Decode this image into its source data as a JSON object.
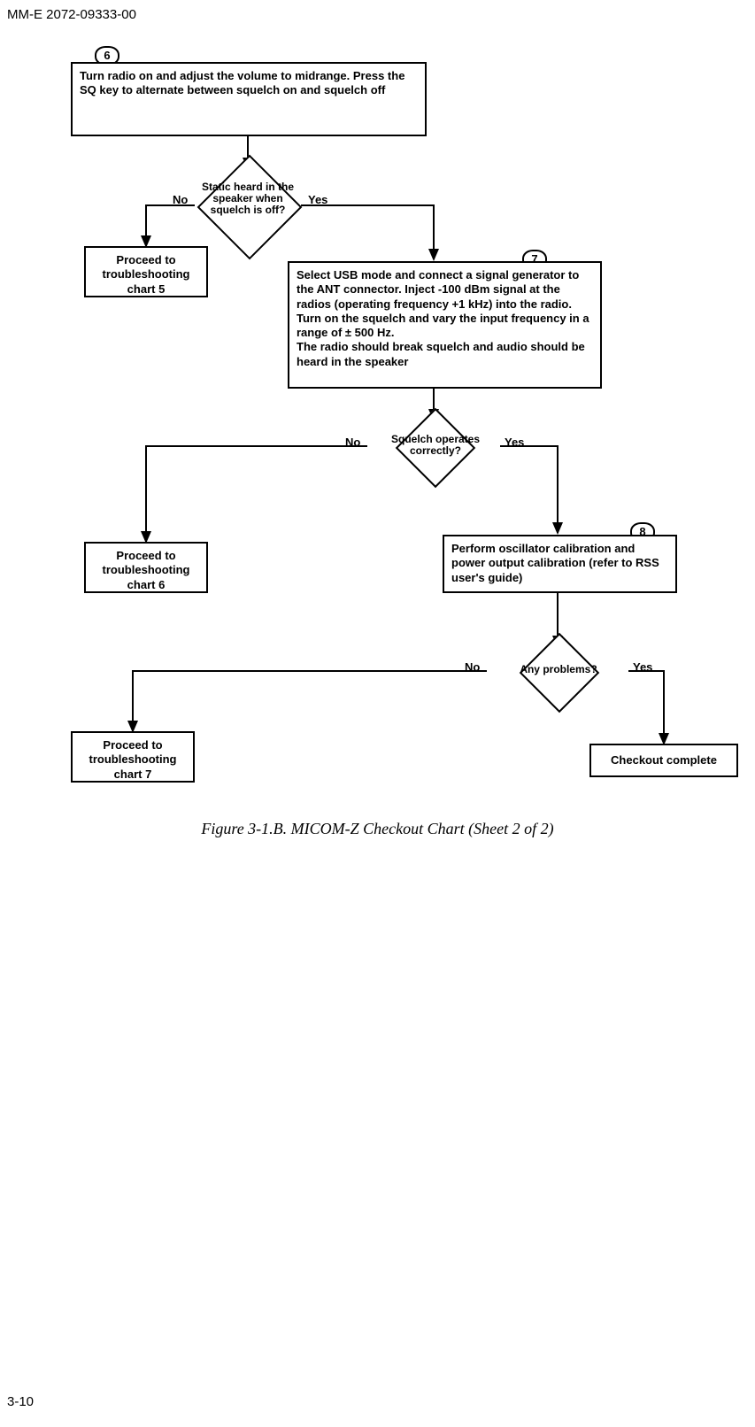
{
  "doc_id": "MM-E 2072-09333-00",
  "page_num": "3-10",
  "caption": "Figure 3-1.B. MICOM-Z Checkout Chart (Sheet 2 of 2)",
  "steps": {
    "s6": "6",
    "s7": "7",
    "s8": "8"
  },
  "boxes": {
    "b6": "Turn radio on and adjust the volume to midrange. Press the SQ key to alternate between squelch on and squelch off",
    "tc5": "Proceed to troubleshooting chart 5",
    "b7": "Select USB mode and connect a signal generator to the ANT connector. Inject -100 dBm signal at the radios (operating frequency +1 kHz) into the radio.  Turn on the squelch and vary the input frequency in a range of ± 500 Hz.\nThe radio should break squelch and audio should be heard in the speaker",
    "tc6": "Proceed to troubleshooting chart 6",
    "b8": "Perform oscillator calibration and power output calibration (refer to RSS user's guide)",
    "tc7": "Proceed to troubleshooting chart 7",
    "done": "Checkout complete"
  },
  "decisions": {
    "d1": "Static heard in the speaker when squelch is off?",
    "d2": "Squelch operates correctly?",
    "d3": "Any problems?"
  },
  "labels": {
    "yes": "Yes",
    "no": "No"
  }
}
